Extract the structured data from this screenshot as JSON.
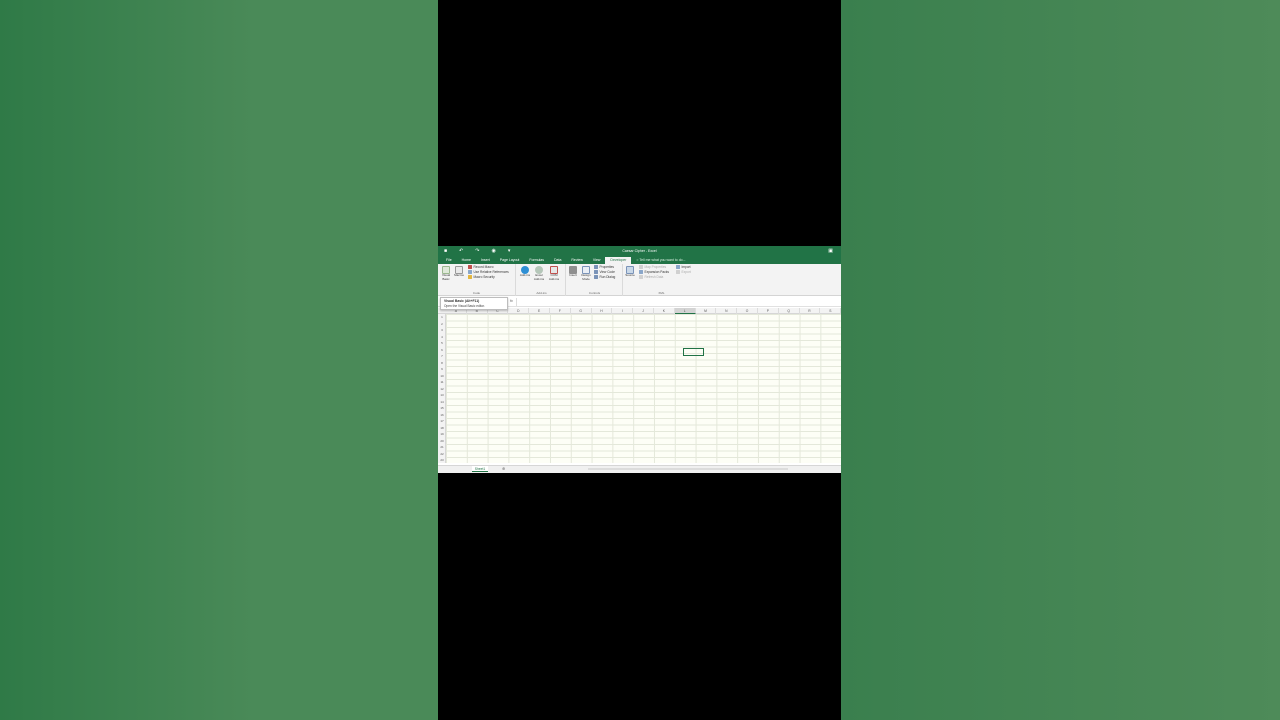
{
  "window": {
    "title": "Caesar Cipher - Excel",
    "qat": [
      "save-icon",
      "undo-icon",
      "redo-icon",
      "camera-icon",
      "customize-icon"
    ]
  },
  "tabs": [
    {
      "label": "File"
    },
    {
      "label": "Home"
    },
    {
      "label": "Insert"
    },
    {
      "label": "Page Layout"
    },
    {
      "label": "Formulas"
    },
    {
      "label": "Data"
    },
    {
      "label": "Review"
    },
    {
      "label": "View"
    },
    {
      "label": "Developer",
      "active": true
    }
  ],
  "tell_me": "Tell me what you want to do...",
  "ribbon": {
    "code": {
      "label": "Code",
      "visual_basic": "Visual Basic",
      "macros": "Macros",
      "record_macro": "Record Macro",
      "relative_refs": "Use Relative References",
      "macro_security": "Macro Security"
    },
    "addins": {
      "label": "Add-ins",
      "addins": "Add-ins",
      "excel_addins": "Excel Add-ins",
      "com_addins": "COM Add-ins"
    },
    "controls": {
      "label": "Controls",
      "insert": "Insert",
      "design_mode": "Design Mode",
      "properties": "Properties",
      "view_code": "View Code",
      "run_dialog": "Run Dialog"
    },
    "xml": {
      "label": "XML",
      "source": "Source",
      "map_properties": "Map Properties",
      "expansion_packs": "Expansion Packs",
      "refresh_data": "Refresh Data",
      "import": "Import",
      "export": "Export"
    }
  },
  "tooltip": {
    "title": "Visual Basic (Alt+F11)",
    "description": "Open the Visual Basic editor."
  },
  "formula_bar": {
    "fx": "fx"
  },
  "columns": [
    "A",
    "B",
    "C",
    "D",
    "E",
    "F",
    "G",
    "H",
    "I",
    "J",
    "K",
    "L",
    "M",
    "N",
    "O",
    "P",
    "Q",
    "R",
    "S"
  ],
  "selected_column": "L",
  "rows": [
    "1",
    "2",
    "3",
    "4",
    "5",
    "6",
    "7",
    "8",
    "9",
    "10",
    "11",
    "12",
    "13",
    "14",
    "15",
    "16",
    "17",
    "18",
    "19",
    "20",
    "21",
    "22",
    "23"
  ],
  "sheets": [
    {
      "label": "Sheet1"
    }
  ],
  "colors": {
    "accent": "#217346"
  }
}
